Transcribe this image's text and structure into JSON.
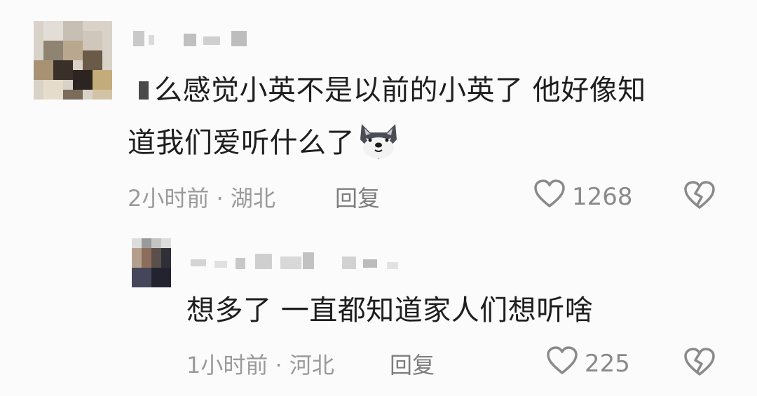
{
  "comments": [
    {
      "text_line1": "么感觉小英不是以前的小英了 他好像知",
      "text_line2": "道我们爱听什么了",
      "emoji": "wolf-face-emoji",
      "time": "2小时前",
      "separator": "·",
      "location": "湖北",
      "reply_label": "回复",
      "like_count": "1268"
    },
    {
      "text": "想多了 一直都知道家人们想听啥",
      "time": "1小时前",
      "separator": "·",
      "location": "河北",
      "reply_label": "回复",
      "like_count": "225"
    }
  ],
  "icons": {
    "like": "heart-outline-icon",
    "dislike": "broken-heart-icon"
  },
  "colors": {
    "background": "#fbfbfb",
    "text": "#1e1e1e",
    "meta": "#9a9a9a",
    "icon": "#8a8a8a"
  }
}
